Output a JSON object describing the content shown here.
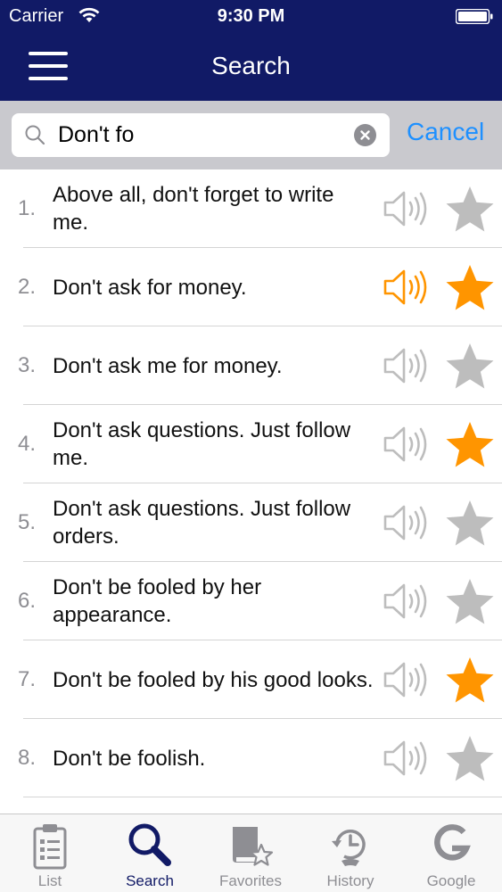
{
  "status_bar": {
    "carrier": "Carrier",
    "time": "9:30 PM"
  },
  "nav": {
    "title": "Search",
    "menu_icon": "hamburger-menu-icon"
  },
  "search": {
    "value": "Don't fo",
    "cancel_label": "Cancel",
    "icon": "search-icon",
    "clear_icon": "clear-icon"
  },
  "colors": {
    "nav_bg": "#111a66",
    "accent": "#1e90ff",
    "active": "#ff9500",
    "inactive": "#bdbdbd"
  },
  "list": {
    "items": [
      {
        "number": "1.",
        "text": "Above all, don't forget to write me.",
        "speaker_active": false,
        "favorite": false
      },
      {
        "number": "2.",
        "text": "Don't ask for money.",
        "speaker_active": true,
        "favorite": true
      },
      {
        "number": "3.",
        "text": "Don't ask me for money.",
        "speaker_active": false,
        "favorite": false
      },
      {
        "number": "4.",
        "text": "Don't ask questions. Just follow me.",
        "speaker_active": false,
        "favorite": true
      },
      {
        "number": "5.",
        "text": "Don't ask questions. Just follow orders.",
        "speaker_active": false,
        "favorite": false
      },
      {
        "number": "6.",
        "text": "Don't be fooled by her appearance.",
        "speaker_active": false,
        "favorite": false
      },
      {
        "number": "7.",
        "text": "Don't be fooled by his good looks.",
        "speaker_active": false,
        "favorite": true
      },
      {
        "number": "8.",
        "text": "Don't be foolish.",
        "speaker_active": false,
        "favorite": false
      }
    ]
  },
  "tabs": [
    {
      "label": "List",
      "icon": "clipboard-list-icon",
      "active": false
    },
    {
      "label": "Search",
      "icon": "search-icon",
      "active": true
    },
    {
      "label": "Favorites",
      "icon": "book-star-icon",
      "active": false
    },
    {
      "label": "History",
      "icon": "history-clock-icon",
      "active": false
    },
    {
      "label": "Google",
      "icon": "google-g-icon",
      "active": false
    }
  ]
}
